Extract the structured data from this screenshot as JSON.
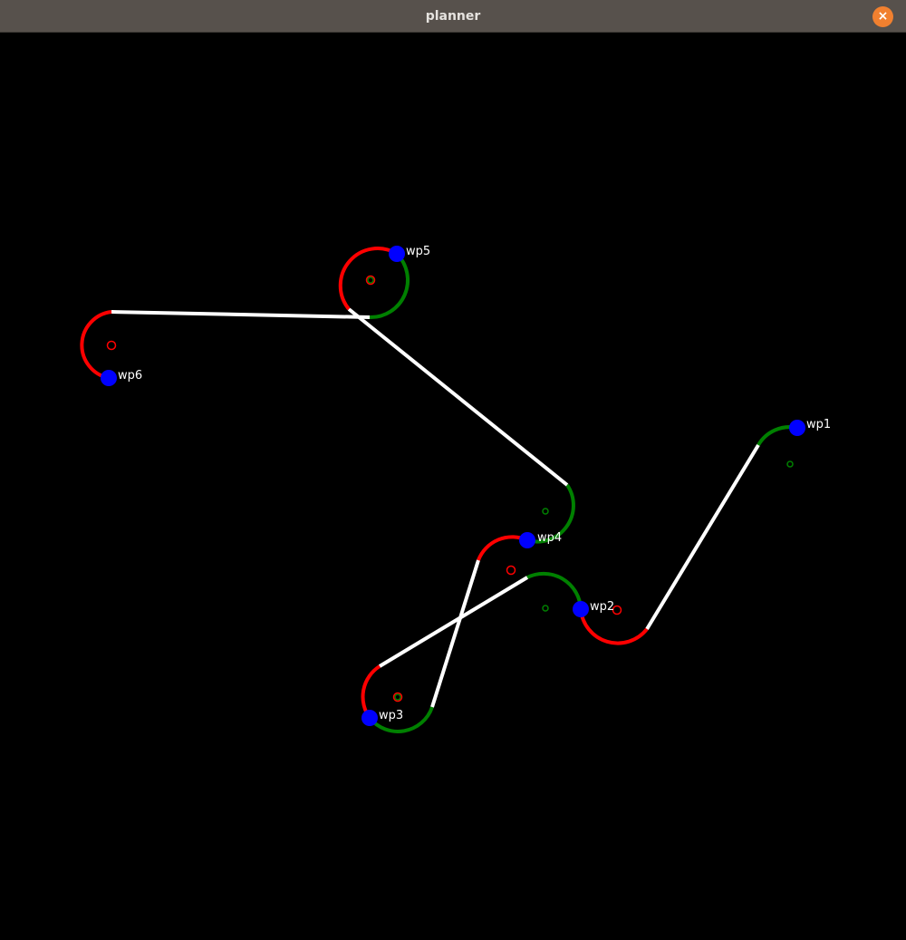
{
  "window": {
    "title": "planner",
    "close_icon": "close-icon",
    "close_glyph": "×"
  },
  "colors": {
    "titlebar": "#57514c",
    "close_button": "#f1802f",
    "background": "#000000",
    "turn_left": "#008000",
    "turn_right": "#ff0000",
    "straight": "#ffffff",
    "waypoint": "#0000ff",
    "label": "#ffffff"
  },
  "waypoints": [
    {
      "label": "wp1"
    },
    {
      "label": "wp2"
    },
    {
      "label": "wp3"
    },
    {
      "label": "wp4"
    },
    {
      "label": "wp5"
    },
    {
      "label": "wp6"
    }
  ]
}
